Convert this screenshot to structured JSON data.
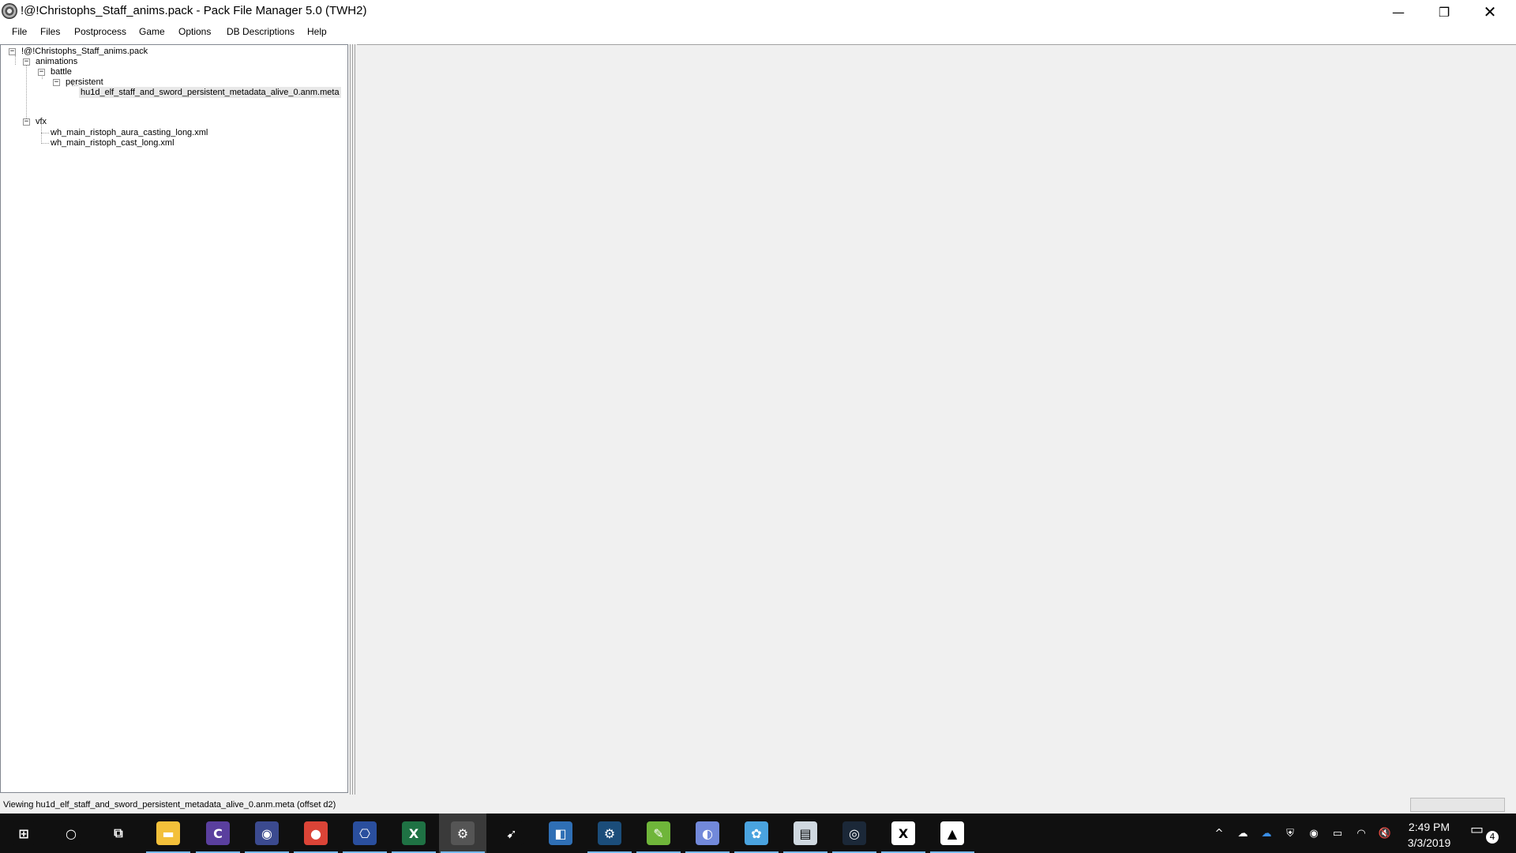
{
  "window": {
    "title": "!@!Christophs_Staff_anims.pack - Pack File Manager 5.0 (TWH2)",
    "icon": "pfm-gear-icon",
    "controls": {
      "minimize": "—",
      "maximize": "❐",
      "close": "✕"
    }
  },
  "menu": {
    "items": [
      "File",
      "Files",
      "Postprocess",
      "Game",
      "Options",
      "DB Descriptions",
      "Help"
    ]
  },
  "tree": {
    "root": "!@!Christophs_Staff_anims.pack",
    "animations": "animations",
    "battle": "battle",
    "persistent": "persistent",
    "selected_file": "hu1d_elf_staff_and_sword_persistent_metadata_alive_0.anm.meta",
    "vfx": "vfx",
    "vfx_file1": "wh_main_ristoph_aura_casting_long.xml",
    "vfx_file2": "wh_main_ristoph_cast_long.xml",
    "expander_symbol": "−"
  },
  "status": {
    "text": "Viewing hu1d_elf_staff_and_sword_persistent_metadata_alive_0.anm.meta (offset d2)"
  },
  "taskbar": {
    "apps": [
      {
        "name": "start-icon",
        "glyph": "⊞",
        "color": "#101010"
      },
      {
        "name": "cortana-icon",
        "glyph": "○",
        "color": "#101010"
      },
      {
        "name": "task-view-icon",
        "glyph": "⧉",
        "color": "#101010"
      },
      {
        "name": "file-explorer-icon",
        "glyph": "▬",
        "color": "#f3c03a"
      },
      {
        "name": "clion-icon",
        "glyph": "C",
        "color": "#5a3f9e"
      },
      {
        "name": "security-app-icon",
        "glyph": "◉",
        "color": "#3b4a8f"
      },
      {
        "name": "chrome-icon",
        "glyph": "●",
        "color": "#db4437"
      },
      {
        "name": "network-app-icon",
        "glyph": "⎔",
        "color": "#2a4f9e"
      },
      {
        "name": "excel-icon",
        "glyph": "X",
        "color": "#1f7244"
      },
      {
        "name": "pack-file-manager-icon",
        "glyph": "⚙",
        "color": "#555555"
      },
      {
        "name": "wand-app-icon",
        "glyph": "➹",
        "color": "#101010"
      },
      {
        "name": "apps-store-icon",
        "glyph": "◧",
        "color": "#2f6fb5"
      },
      {
        "name": "steam-gear-icon",
        "glyph": "⚙",
        "color": "#1b4d7a"
      },
      {
        "name": "notepad-icon",
        "glyph": "✎",
        "color": "#6fb53a"
      },
      {
        "name": "discord-icon",
        "glyph": "◐",
        "color": "#7289da"
      },
      {
        "name": "paint-icon",
        "glyph": "✿",
        "color": "#4aa3df"
      },
      {
        "name": "chart-app-icon",
        "glyph": "▤",
        "color": "#cfd8e0"
      },
      {
        "name": "steam-icon",
        "glyph": "◎",
        "color": "#1b2838"
      },
      {
        "name": "xd-app-icon",
        "glyph": "X",
        "color": "#ffffff"
      },
      {
        "name": "photos-icon",
        "glyph": "▲",
        "color": "#ffffff"
      }
    ],
    "tray": {
      "chevron": "^",
      "onedrive1": "☁",
      "onedrive2": "☁",
      "defender": "⛨",
      "vpn": "◉",
      "battery": "▭",
      "wifi": "◠",
      "volume": "🔇",
      "time": "2:49 PM",
      "date": "3/3/2019",
      "notifications_count": "4",
      "notification_glyph": "▭"
    }
  }
}
